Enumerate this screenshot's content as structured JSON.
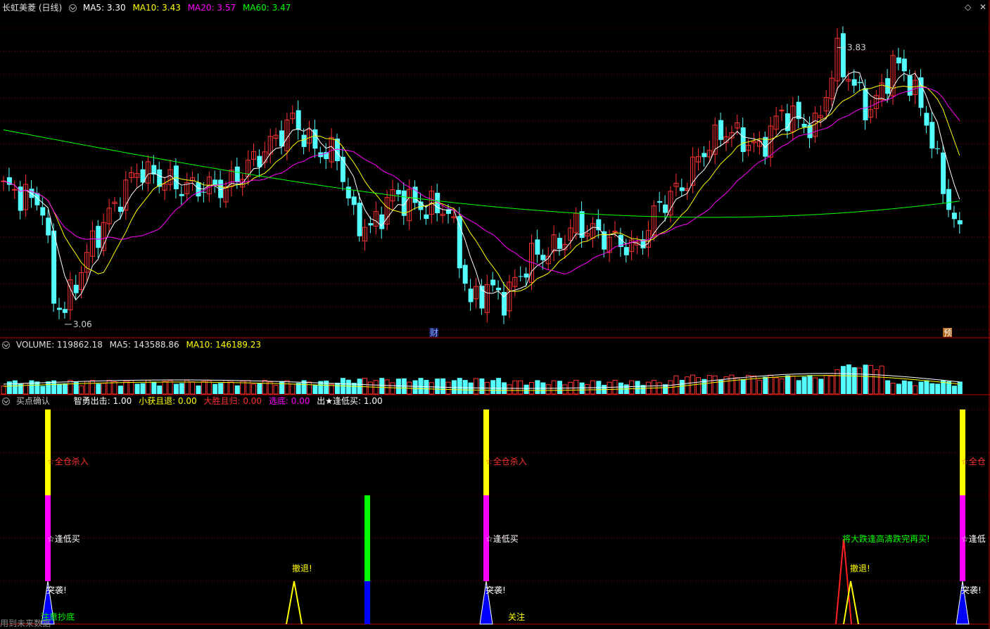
{
  "main": {
    "title": "长虹美菱 (日线)",
    "ma5": "MA5: 3.30",
    "ma10": "MA10: 3.43",
    "ma20": "MA20: 3.57",
    "ma60": "MA60: 3.47",
    "high_label": "3.83",
    "low_label": "3.06",
    "marker_cai": "财",
    "marker_yu": "预"
  },
  "volume": {
    "label": "VOLUME: 119862.18",
    "ma5": "MA5: 143588.86",
    "ma10": "MA10: 146189.23"
  },
  "signal": {
    "name": "买点确认",
    "i1": "智勇出击: 1.00",
    "i2": "小获且退: 0.00",
    "i3": "大胜且归: 0.00",
    "i4": "选底: 0.00",
    "i5": "出★逢低买: 1.00",
    "texts": {
      "quancang": "☆全仓杀入",
      "fengdi": "☆逢低买",
      "tuxi": "突袭!",
      "chetui": "撤退!",
      "guanzhu": "关注",
      "dadie": "将大跌逢高清跌完再买!",
      "xuanze": "注意抄底",
      "quancang_r": "☆全仓",
      "fengdi_r": "☆逢低"
    }
  },
  "footer": "用到未来数据",
  "colors": {
    "bg": "#000000",
    "up": "#ff3232",
    "down": "#54ffff",
    "ma5": "#ffffff",
    "ma10": "#ffff00",
    "ma20": "#ff00ff",
    "ma60": "#00ff00",
    "grid": "#800000"
  },
  "chart_data": {
    "type": "candlestick",
    "price_high": 3.83,
    "price_low": 3.06,
    "series": [
      {
        "name": "MA5",
        "values": [
          3.3
        ]
      },
      {
        "name": "MA10",
        "values": [
          3.43
        ]
      },
      {
        "name": "MA20",
        "values": [
          3.57
        ]
      },
      {
        "name": "MA60",
        "values": [
          3.47
        ]
      },
      {
        "name": "VOLUME",
        "values": [
          119862.18
        ]
      },
      {
        "name": "VOLUME MA5",
        "values": [
          143588.86
        ]
      },
      {
        "name": "VOLUME MA10",
        "values": [
          146189.23
        ]
      },
      {
        "name": "智勇出击",
        "values": [
          1.0
        ]
      },
      {
        "name": "小获且退",
        "values": [
          0.0
        ]
      },
      {
        "name": "大胜且归",
        "values": [
          0.0
        ]
      },
      {
        "name": "选底",
        "values": [
          0.0
        ]
      },
      {
        "name": "出★逢低买",
        "values": [
          1.0
        ]
      }
    ]
  }
}
